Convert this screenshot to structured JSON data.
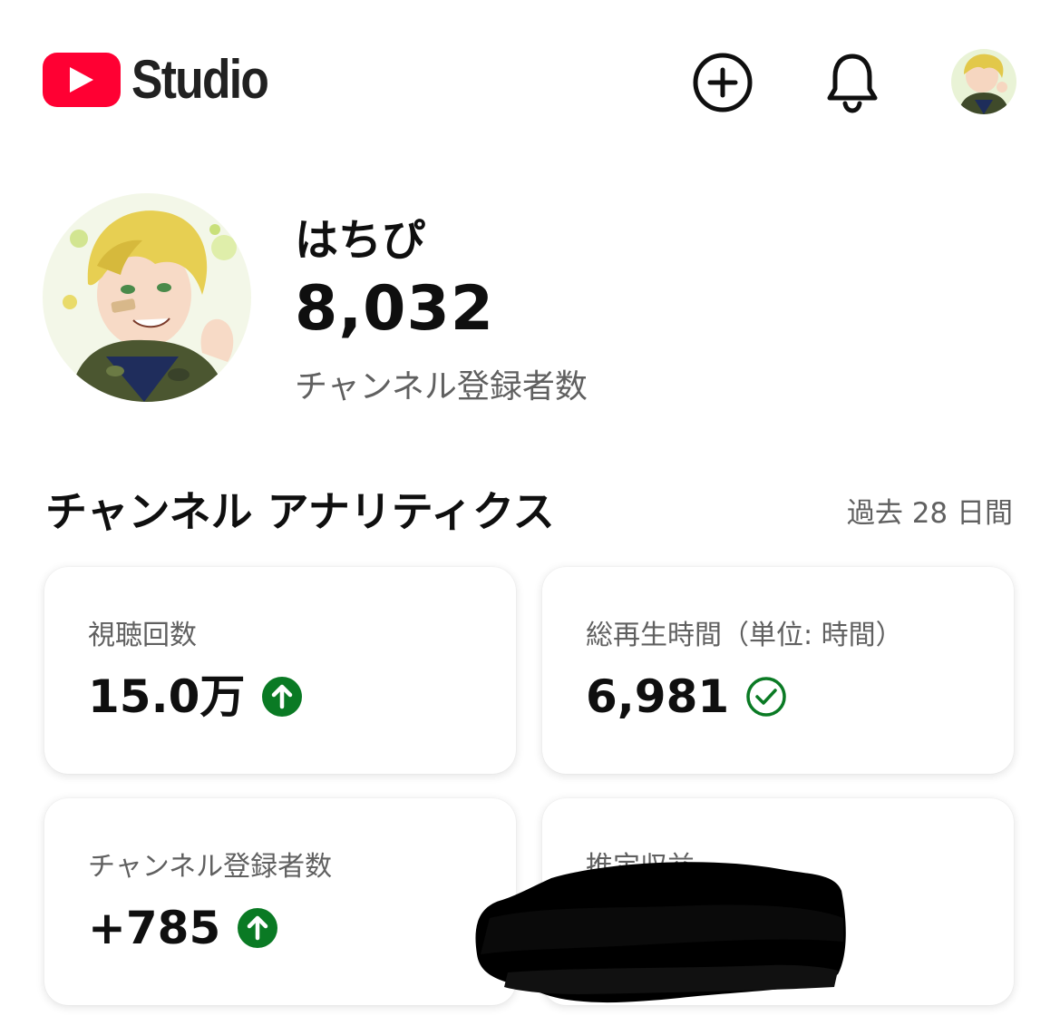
{
  "header": {
    "logo_text": "Studio",
    "icons": [
      "youtube-logo-icon",
      "create-plus-icon",
      "notifications-bell-icon",
      "account-avatar"
    ]
  },
  "channel": {
    "name": "はちぴ",
    "subscriber_count": "8,032",
    "subscriber_label": "チャンネル登録者数"
  },
  "analytics": {
    "title": "チャンネル アナリティクス",
    "period": "過去 28 日間",
    "cards": [
      {
        "label": "視聴回数",
        "value": "15.0万",
        "status_icon": "trend-up-icon"
      },
      {
        "label": "総再生時間（単位: 時間）",
        "value": "6,981",
        "status_icon": "check-circle-icon"
      },
      {
        "label": "チャンネル登録者数",
        "value": "+785",
        "status_icon": "trend-up-icon"
      },
      {
        "label": "推定収益",
        "value": "",
        "status_icon": ""
      }
    ]
  },
  "colors": {
    "brand_red": "#ff0033",
    "positive_green": "#0a7a24",
    "text_primary": "#0f0f0f",
    "text_secondary": "#606060"
  }
}
